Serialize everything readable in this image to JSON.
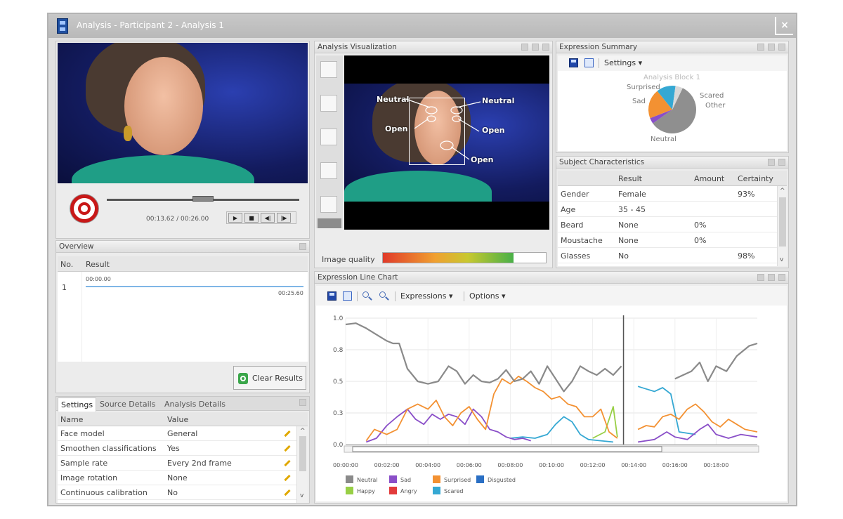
{
  "window": {
    "title": "Analysis - Participant 2 - Analysis 1",
    "close_label": "×"
  },
  "player": {
    "time_display": "00:13.62 / 00:26.00",
    "play_label": "▶",
    "stop_label": "■",
    "prev_label": "◀|",
    "next_label": "|▶",
    "progress": 0.5
  },
  "overview": {
    "title": "Overview",
    "columns": [
      "No.",
      "Result"
    ],
    "row": {
      "no": "1",
      "start": "00:00.00",
      "end": "00:25.60"
    },
    "clear_label": "Clear Results"
  },
  "settings": {
    "tabs": [
      "Settings",
      "Source Details",
      "Analysis Details"
    ],
    "columns": [
      "Name",
      "Value"
    ],
    "rows": [
      {
        "name": "Face model",
        "value": "General"
      },
      {
        "name": "Smoothen classifications",
        "value": "Yes"
      },
      {
        "name": "Sample rate",
        "value": "Every 2nd frame"
      },
      {
        "name": "Image rotation",
        "value": "None"
      },
      {
        "name": "Continuous calibration",
        "value": "No"
      }
    ]
  },
  "visualization": {
    "title": "Analysis Visualization",
    "labels": {
      "left_brow": "Neutral",
      "right_brow": "Neutral",
      "left_eye": "Open",
      "right_eye": "Open",
      "mouth": "Open"
    },
    "quality_label": "Image quality",
    "quality_value": 0.8
  },
  "summary": {
    "title": "Expression Summary",
    "settings_label": "Settings",
    "pie_title": "Analysis Block 1",
    "slices": [
      {
        "label": "Neutral",
        "value": 0.58,
        "color": "#8f8f8f"
      },
      {
        "label": "Sad",
        "value": 0.04,
        "color": "#8a4fc8"
      },
      {
        "label": "Surprised",
        "value": 0.2,
        "color": "#f39132"
      },
      {
        "label": "Scared",
        "value": 0.13,
        "color": "#35a8d3"
      },
      {
        "label": "Other",
        "value": 0.05,
        "color": "#d8d8d8"
      }
    ]
  },
  "subject": {
    "title": "Subject Characteristics",
    "columns": [
      "",
      "Result",
      "Amount",
      "Certainty"
    ],
    "rows": [
      {
        "name": "Gender",
        "result": "Female",
        "amount": "",
        "certainty": "93%"
      },
      {
        "name": "Age",
        "result": "35 - 45",
        "amount": "",
        "certainty": ""
      },
      {
        "name": "Beard",
        "result": "None",
        "amount": "0%",
        "certainty": ""
      },
      {
        "name": "Moustache",
        "result": "None",
        "amount": "0%",
        "certainty": ""
      },
      {
        "name": "Glasses",
        "result": "No",
        "amount": "",
        "certainty": "98%"
      }
    ]
  },
  "linechart": {
    "title": "Expression Line Chart",
    "menu_expressions": "Expressions",
    "menu_options": "Options"
  },
  "chart_data": {
    "type": "line",
    "x_ticks": [
      "00:00:00",
      "00:02:00",
      "00:04:00",
      "00:06:00",
      "00:08:00",
      "00:10:00",
      "00:12:00",
      "00:14:00",
      "00:16:00",
      "00:18:00"
    ],
    "y_ticks": [
      "1.0",
      "0.8",
      "0.5",
      "0.3",
      "0.0"
    ],
    "xlim": [
      0,
      20
    ],
    "ylim": [
      0,
      1.0
    ],
    "cursor_x": 13.5,
    "legend": [
      {
        "name": "Neutral",
        "color": "#8a8a8a"
      },
      {
        "name": "Sad",
        "color": "#8a4fc8"
      },
      {
        "name": "Surprised",
        "color": "#f39132"
      },
      {
        "name": "Disgusted",
        "color": "#2a6fc4"
      },
      {
        "name": "Happy",
        "color": "#98cf45"
      },
      {
        "name": "Angry",
        "color": "#e23b3b"
      },
      {
        "name": "Scared",
        "color": "#35a8d3"
      }
    ],
    "series": [
      {
        "name": "Neutral",
        "color": "#8a8a8a",
        "points": [
          [
            0,
            0.95
          ],
          [
            0.5,
            0.96
          ],
          [
            1,
            0.92
          ],
          [
            1.5,
            0.87
          ],
          [
            2,
            0.82
          ],
          [
            2.3,
            0.8
          ],
          [
            2.6,
            0.8
          ],
          [
            3,
            0.6
          ],
          [
            3.5,
            0.5
          ],
          [
            4,
            0.48
          ],
          [
            4.5,
            0.5
          ],
          [
            5,
            0.62
          ],
          [
            5.4,
            0.58
          ],
          [
            5.8,
            0.48
          ],
          [
            6.2,
            0.55
          ],
          [
            6.6,
            0.5
          ],
          [
            7,
            0.49
          ],
          [
            7.4,
            0.52
          ],
          [
            7.8,
            0.59
          ],
          [
            8.2,
            0.5
          ],
          [
            8.6,
            0.52
          ],
          [
            9,
            0.58
          ],
          [
            9.4,
            0.48
          ],
          [
            9.8,
            0.62
          ],
          [
            10.2,
            0.52
          ],
          [
            10.6,
            0.42
          ],
          [
            11,
            0.5
          ],
          [
            11.4,
            0.62
          ],
          [
            11.8,
            0.58
          ],
          [
            12.2,
            0.55
          ],
          [
            12.6,
            0.6
          ],
          [
            13,
            0.55
          ],
          [
            13.4,
            0.62
          ],
          [
            16,
            0.52
          ],
          [
            16.4,
            0.55
          ],
          [
            16.8,
            0.58
          ],
          [
            17.2,
            0.65
          ],
          [
            17.6,
            0.5
          ],
          [
            18,
            0.62
          ],
          [
            18.5,
            0.58
          ],
          [
            19,
            0.7
          ],
          [
            19.6,
            0.78
          ],
          [
            20,
            0.8
          ]
        ]
      },
      {
        "name": "Surprised",
        "color": "#f39132",
        "points": [
          [
            0,
            0.02
          ],
          [
            1,
            0.03
          ],
          [
            1.4,
            0.12
          ],
          [
            2,
            0.08
          ],
          [
            2.5,
            0.12
          ],
          [
            3,
            0.28
          ],
          [
            3.5,
            0.32
          ],
          [
            4,
            0.28
          ],
          [
            4.4,
            0.35
          ],
          [
            4.8,
            0.22
          ],
          [
            5.2,
            0.15
          ],
          [
            5.6,
            0.25
          ],
          [
            6,
            0.3
          ],
          [
            6.4,
            0.2
          ],
          [
            6.8,
            0.12
          ],
          [
            7.2,
            0.4
          ],
          [
            7.6,
            0.52
          ],
          [
            8,
            0.48
          ],
          [
            8.4,
            0.54
          ],
          [
            8.8,
            0.5
          ],
          [
            9.2,
            0.45
          ],
          [
            9.6,
            0.42
          ],
          [
            10,
            0.36
          ],
          [
            10.4,
            0.38
          ],
          [
            10.8,
            0.32
          ],
          [
            11.2,
            0.3
          ],
          [
            11.6,
            0.22
          ],
          [
            12,
            0.22
          ],
          [
            12.4,
            0.28
          ],
          [
            12.8,
            0.1
          ],
          [
            13.2,
            0.05
          ],
          [
            14.2,
            0.12
          ],
          [
            14.6,
            0.15
          ],
          [
            15,
            0.14
          ],
          [
            15.4,
            0.22
          ],
          [
            15.8,
            0.24
          ],
          [
            16.2,
            0.2
          ],
          [
            16.6,
            0.28
          ],
          [
            17,
            0.32
          ],
          [
            17.4,
            0.26
          ],
          [
            17.8,
            0.18
          ],
          [
            18.2,
            0.14
          ],
          [
            18.6,
            0.2
          ],
          [
            19,
            0.16
          ],
          [
            19.4,
            0.12
          ],
          [
            20,
            0.1
          ]
        ]
      },
      {
        "name": "Sad",
        "color": "#8a4fc8",
        "points": [
          [
            0,
            0.01
          ],
          [
            1,
            0.02
          ],
          [
            1.5,
            0.05
          ],
          [
            2,
            0.15
          ],
          [
            2.5,
            0.22
          ],
          [
            3,
            0.28
          ],
          [
            3.4,
            0.2
          ],
          [
            3.8,
            0.16
          ],
          [
            4.2,
            0.24
          ],
          [
            4.6,
            0.2
          ],
          [
            5,
            0.24
          ],
          [
            5.4,
            0.22
          ],
          [
            5.8,
            0.16
          ],
          [
            6.2,
            0.28
          ],
          [
            6.6,
            0.22
          ],
          [
            7,
            0.12
          ],
          [
            7.4,
            0.1
          ],
          [
            7.8,
            0.06
          ],
          [
            8.2,
            0.04
          ],
          [
            8.6,
            0.05
          ],
          [
            9,
            0.03
          ],
          [
            10,
            0.02
          ],
          [
            11,
            0.03
          ],
          [
            12,
            0.02
          ],
          [
            13,
            0.02
          ],
          [
            14.2,
            0.02
          ],
          [
            15,
            0.04
          ],
          [
            15.6,
            0.1
          ],
          [
            16,
            0.06
          ],
          [
            16.6,
            0.04
          ],
          [
            17.2,
            0.12
          ],
          [
            17.6,
            0.16
          ],
          [
            18,
            0.08
          ],
          [
            18.6,
            0.05
          ],
          [
            19.2,
            0.08
          ],
          [
            20,
            0.06
          ]
        ]
      },
      {
        "name": "Scared",
        "color": "#35a8d3",
        "points": [
          [
            0,
            0.02
          ],
          [
            2,
            0.02
          ],
          [
            4,
            0.03
          ],
          [
            6,
            0.05
          ],
          [
            7,
            0.03
          ],
          [
            8,
            0.05
          ],
          [
            8.6,
            0.06
          ],
          [
            9.2,
            0.05
          ],
          [
            9.8,
            0.08
          ],
          [
            10.2,
            0.16
          ],
          [
            10.6,
            0.22
          ],
          [
            11,
            0.18
          ],
          [
            11.4,
            0.08
          ],
          [
            11.8,
            0.04
          ],
          [
            12.4,
            0.03
          ],
          [
            13,
            0.02
          ],
          [
            14.2,
            0.46
          ],
          [
            14.6,
            0.44
          ],
          [
            15,
            0.42
          ],
          [
            15.4,
            0.45
          ],
          [
            15.8,
            0.4
          ],
          [
            16.2,
            0.1
          ],
          [
            17,
            0.08
          ],
          [
            18,
            0.06
          ],
          [
            19,
            0.05
          ],
          [
            20,
            0.04
          ]
        ]
      },
      {
        "name": "Happy",
        "color": "#98cf45",
        "points": [
          [
            0,
            0.01
          ],
          [
            2,
            0.02
          ],
          [
            4,
            0.04
          ],
          [
            5,
            0.02
          ],
          [
            6,
            0.03
          ],
          [
            7,
            0.02
          ],
          [
            8,
            0.03
          ],
          [
            9,
            0.02
          ],
          [
            10,
            0.03
          ],
          [
            11,
            0.02
          ],
          [
            12,
            0.05
          ],
          [
            12.6,
            0.1
          ],
          [
            13,
            0.3
          ],
          [
            13.2,
            0.06
          ],
          [
            14.2,
            0.02
          ],
          [
            16,
            0.03
          ],
          [
            18,
            0.02
          ],
          [
            20,
            0.02
          ]
        ]
      },
      {
        "name": "Angry",
        "color": "#e23b3b",
        "points": [
          [
            0,
            0.01
          ],
          [
            1,
            0.02
          ],
          [
            2,
            0.01
          ],
          [
            4,
            0.02
          ],
          [
            6,
            0.01
          ],
          [
            8,
            0.02
          ],
          [
            10,
            0.01
          ],
          [
            12,
            0.02
          ],
          [
            13,
            0.01
          ],
          [
            14.2,
            0.01
          ],
          [
            16,
            0.02
          ],
          [
            18,
            0.01
          ],
          [
            20,
            0.02
          ]
        ]
      },
      {
        "name": "Disgusted",
        "color": "#2a6fc4",
        "points": [
          [
            0,
            0.0
          ],
          [
            2,
            0.01
          ],
          [
            4,
            0.0
          ],
          [
            6,
            0.01
          ],
          [
            8,
            0.0
          ],
          [
            10,
            0.01
          ],
          [
            12,
            0.0
          ],
          [
            13,
            0.01
          ],
          [
            14.2,
            0.0
          ],
          [
            16,
            0.01
          ],
          [
            18,
            0.0
          ],
          [
            20,
            0.01
          ]
        ]
      }
    ]
  }
}
